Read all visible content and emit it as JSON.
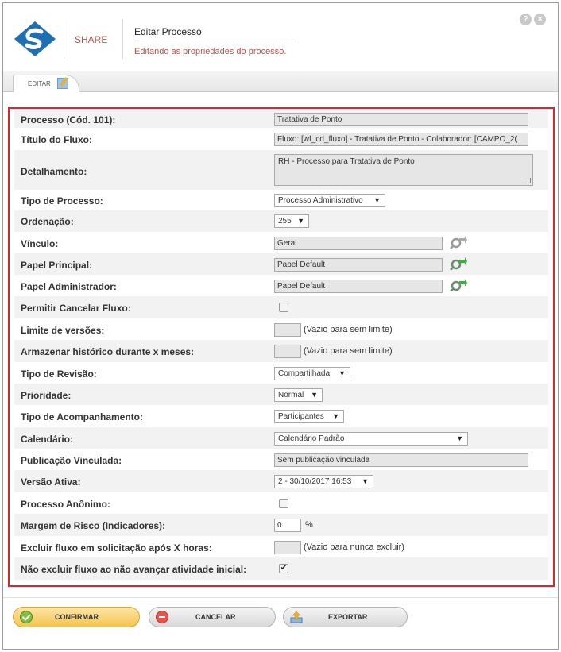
{
  "header": {
    "brand": "SHARE",
    "title": "Editar Processo",
    "subtitle": "Editando as propriedades do processo.",
    "help_label": "?",
    "close_label": "×"
  },
  "tabs": [
    {
      "label": "EDITAR"
    }
  ],
  "form": {
    "processo": {
      "label": "Processo (Cód. 101):",
      "value": "Tratativa de Ponto"
    },
    "titulo_fluxo": {
      "label": "Título do Fluxo:",
      "value": "Fluxo: [wf_cd_fluxo] - Tratativa de Ponto - Colaborador: [CAMPO_2("
    },
    "detalhamento": {
      "label": "Detalhamento:",
      "value": "RH - Processo para Tratativa de Ponto"
    },
    "tipo_processo": {
      "label": "Tipo de Processo:",
      "value": "Processo Administrativo"
    },
    "ordenacao": {
      "label": "Ordenação:",
      "value": "255"
    },
    "vinculo": {
      "label": "Vínculo:",
      "value": "Geral"
    },
    "papel_principal": {
      "label": "Papel Principal:",
      "value": "Papel Default"
    },
    "papel_administrador": {
      "label": "Papel Administrador:",
      "value": "Papel Default"
    },
    "permitir_cancelar": {
      "label": "Permitir Cancelar Fluxo:",
      "checked": false
    },
    "limite_versoes": {
      "label": "Limite de versões:",
      "value": "",
      "hint": "(Vazio para sem limite)"
    },
    "armazenar_historico": {
      "label": "Armazenar histórico durante x meses:",
      "value": "",
      "hint": "(Vazio para sem limite)"
    },
    "tipo_revisao": {
      "label": "Tipo de Revisão:",
      "value": "Compartilhada"
    },
    "prioridade": {
      "label": "Prioridade:",
      "value": "Normal"
    },
    "tipo_acompanhamento": {
      "label": "Tipo de Acompanhamento:",
      "value": "Participantes"
    },
    "calendario": {
      "label": "Calendário:",
      "value": "Calendário Padrão"
    },
    "publicacao_vinculada": {
      "label": "Publicação Vinculada:",
      "value": "Sem publicação vinculada"
    },
    "versao_ativa": {
      "label": "Versão Ativa:",
      "value": "2 - 30/10/2017 16:53"
    },
    "processo_anonimo": {
      "label": "Processo Anônimo:",
      "checked": false
    },
    "margem_risco": {
      "label": "Margem de Risco (Indicadores):",
      "value": "0",
      "unit": "%"
    },
    "excluir_fluxo": {
      "label": "Excluir fluxo em solicitação após X horas:",
      "value": "",
      "hint": "(Vazio para nunca excluir)"
    },
    "nao_excluir_fluxo": {
      "label": "Não excluir fluxo ao não avançar atividade inicial:",
      "checked": true
    }
  },
  "buttons": {
    "confirmar": "CONFIRMAR",
    "cancelar": "CANCELAR",
    "exportar": "EXPORTAR"
  },
  "colors": {
    "accent_red": "#e8202a",
    "brand_text": "#c0504d",
    "confirm_button": "#f4c34e"
  }
}
